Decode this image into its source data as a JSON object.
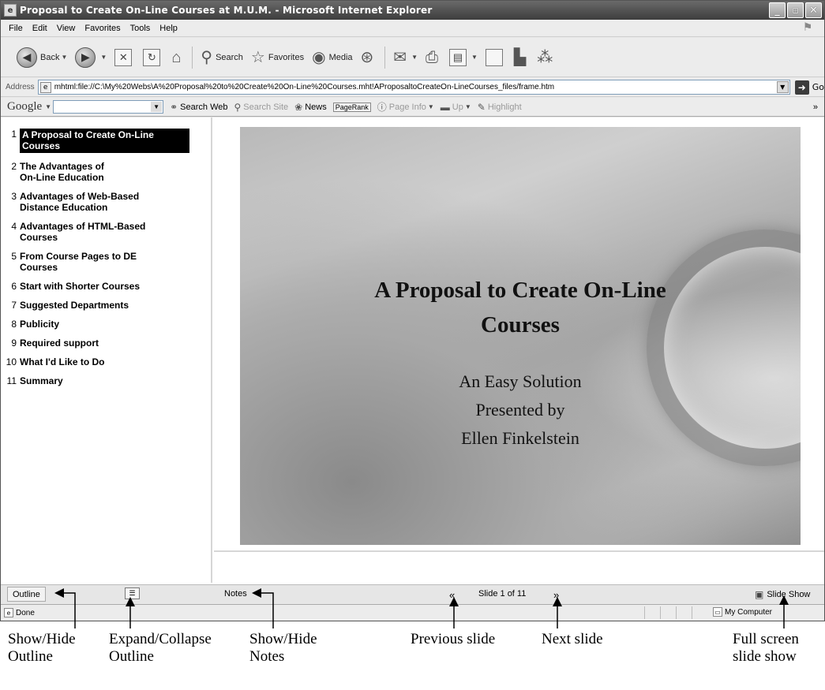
{
  "window": {
    "title": "Proposal to Create On-Line Courses at M.U.M. - Microsoft Internet Explorer",
    "buttons": [
      "minimize",
      "maximize",
      "close"
    ]
  },
  "menubar": {
    "items": [
      "File",
      "Edit",
      "View",
      "Favorites",
      "Tools",
      "Help"
    ]
  },
  "toolbar": {
    "back_label": "Back",
    "search_label": "Search",
    "favorites_label": "Favorites",
    "media_label": "Media",
    "icons": [
      "back-icon",
      "forward-icon",
      "stop-icon",
      "refresh-icon",
      "home-icon",
      "search-icon",
      "favorites-icon",
      "media-icon",
      "history-icon",
      "mail-icon",
      "print-icon",
      "edit-icon",
      "discuss-icon",
      "research-icon",
      "messenger-icon"
    ]
  },
  "address": {
    "label": "Address",
    "url": "mhtml:file://C:\\My%20Webs\\A%20Proposal%20to%20Create%20On-Line%20Courses.mht!AProposaltoCreateOn-LineCourses_files/frame.htm",
    "go_label": "Go"
  },
  "googlebar": {
    "logo": "Google",
    "search_web": "Search Web",
    "search_site": "Search Site",
    "news": "News",
    "pagerank": "PageRank",
    "page_info": "Page Info",
    "up": "Up",
    "highlight": "Highlight",
    "more": "»"
  },
  "outline": {
    "items": [
      {
        "num": "1",
        "label": "A Proposal to Create On-Line\nCourses",
        "active": true
      },
      {
        "num": "2",
        "label": "The Advantages of\nOn-Line Education"
      },
      {
        "num": "3",
        "label": "Advantages of Web-Based\nDistance Education"
      },
      {
        "num": "4",
        "label": "Advantages of HTML-Based\nCourses"
      },
      {
        "num": "5",
        "label": "From Course Pages to DE\nCourses"
      },
      {
        "num": "6",
        "label": "Start with Shorter Courses"
      },
      {
        "num": "7",
        "label": "Suggested Departments"
      },
      {
        "num": "8",
        "label": "Publicity"
      },
      {
        "num": "9",
        "label": "Required support"
      },
      {
        "num": "10",
        "label": "What I'd Like to Do"
      },
      {
        "num": "11",
        "label": "Summary"
      }
    ]
  },
  "slide": {
    "title": "A Proposal to Create On-Line\nCourses",
    "subtitle_lines": [
      "An Easy Solution",
      "Presented by",
      "Ellen Finkelstein"
    ]
  },
  "controls": {
    "outline_label": "Outline",
    "notes_label": "Notes",
    "slide_counter": "Slide 1 of 11",
    "slideshow_label": "Slide Show"
  },
  "status": {
    "left": "Done",
    "zone": "My Computer"
  },
  "annotations": {
    "show_hide_outline": "Show/Hide\nOutline",
    "expand_collapse_outline": "Expand/Collapse\nOutline",
    "show_hide_notes": "Show/Hide\nNotes",
    "previous_slide": "Previous slide",
    "next_slide": "Next slide",
    "full_screen_slide_show": "Full screen\nslide show"
  }
}
